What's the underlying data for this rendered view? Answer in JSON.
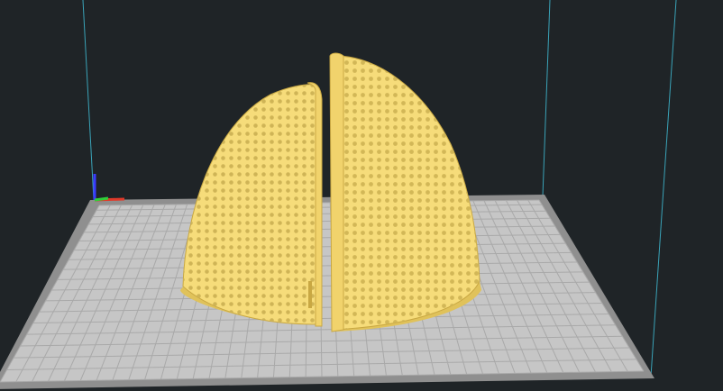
{
  "viewport": {
    "background_color": "#1f2427",
    "build_volume_edge_color": "#3aa3b8",
    "build_plate": {
      "surface_color": "#c6c6c6",
      "grid_line_color": "#a9a9a9",
      "border_color": "#8f8f8f",
      "edge_color": "#7a7a7a"
    },
    "axes_gizmo": {
      "x_color": "#e03a2a",
      "y_color": "#2fcf3a",
      "z_color": "#3a3aff"
    },
    "model": {
      "description_icon": "dome-halves-model-icon",
      "fill_color": "#f6dc7a",
      "shade_color": "#e0c25a",
      "perforation_color": "#d5b95a",
      "outline_color": "#c9a843"
    }
  }
}
